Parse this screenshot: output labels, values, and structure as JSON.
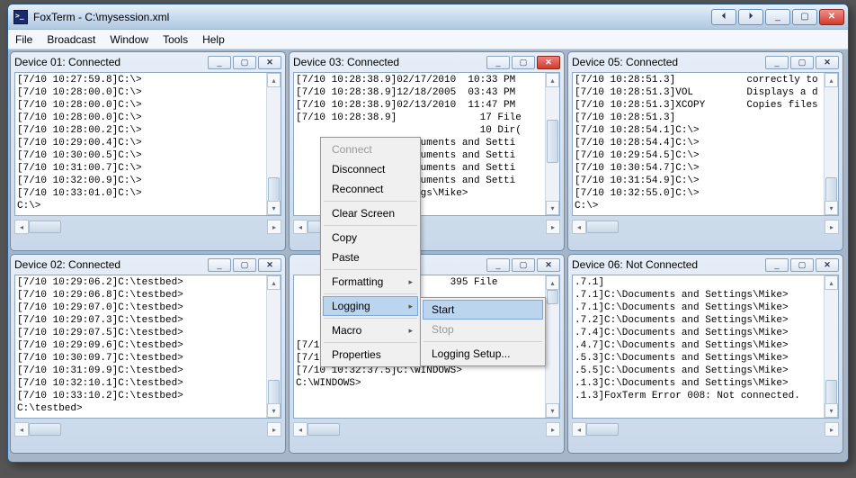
{
  "window": {
    "title": "FoxTerm - C:\\mysession.xml"
  },
  "titlebar_buttons": {
    "prev": "⏴",
    "next": "⏵",
    "min": "_",
    "max": "▢",
    "close": ""
  },
  "menubar": [
    "File",
    "Broadcast",
    "Window",
    "Tools",
    "Help"
  ],
  "children": {
    "d1": {
      "title": "Device 01: Connected",
      "lines": "[7/10 10:27:59.8]C:\\>\n[7/10 10:28:00.0]C:\\>\n[7/10 10:28:00.0]C:\\>\n[7/10 10:28:00.0]C:\\>\n[7/10 10:28:00.2]C:\\>\n[7/10 10:29:00.4]C:\\>\n[7/10 10:30:00.5]C:\\>\n[7/10 10:31:00.7]C:\\>\n[7/10 10:32:00.9]C:\\>\n[7/10 10:33:01.0]C:\\>\nC:\\>"
    },
    "d2": {
      "title": "Device 02: Connected",
      "lines": "[7/10 10:29:06.2]C:\\testbed>\n[7/10 10:29:06.8]C:\\testbed>\n[7/10 10:29:07.0]C:\\testbed>\n[7/10 10:29:07.3]C:\\testbed>\n[7/10 10:29:07.5]C:\\testbed>\n[7/10 10:29:09.6]C:\\testbed>\n[7/10 10:30:09.7]C:\\testbed>\n[7/10 10:31:09.9]C:\\testbed>\n[7/10 10:32:10.1]C:\\testbed>\n[7/10 10:33:10.2]C:\\testbed>\nC:\\testbed>"
    },
    "d3": {
      "title": "Device 03: Connected",
      "lines": "[7/10 10:28:38.9]02/17/2010  10:33 PM\n[7/10 10:28:38.9]12/18/2005  03:43 PM\n[7/10 10:28:38.9]02/13/2010  11:47 PM\n[7/10 10:28:38.9]              17 File\n                               10 Dir(\n                  Documents and Setti\n                  Documents and Setti\n                  Documents and Setti\n                  Documents and Setti\n                  tings\\Mike>"
    },
    "d4": {
      "title": "",
      "lines": "                          395 File\n\n\n\n                  NDOWS>\n[7/10 10:30:37.1]C:\\WINDOWS>\n[7/10 10:31:37.3]C:\\WINDOWS>\n[7/10 10:32:37.5]C:\\WINDOWS>\nC:\\WINDOWS>"
    },
    "d5": {
      "title": "Device 05: Connected",
      "lines": "[7/10 10:28:51.3]            correctly to\n[7/10 10:28:51.3]VOL         Displays a d\n[7/10 10:28:51.3]XCOPY       Copies files\n[7/10 10:28:51.3]\n[7/10 10:28:54.1]C:\\>\n[7/10 10:28:54.4]C:\\>\n[7/10 10:29:54.5]C:\\>\n[7/10 10:30:54.7]C:\\>\n[7/10 10:31:54.9]C:\\>\n[7/10 10:32:55.0]C:\\>\nC:\\>"
    },
    "d6": {
      "title": "Device 06: Not Connected",
      "lines": ".7.1]\n.7.1]C:\\Documents and Settings\\Mike>\n.7.1]C:\\Documents and Settings\\Mike>\n.7.2]C:\\Documents and Settings\\Mike>\n.7.4]C:\\Documents and Settings\\Mike>\n.4.7]C:\\Documents and Settings\\Mike>\n.5.3]C:\\Documents and Settings\\Mike>\n.5.5]C:\\Documents and Settings\\Mike>\n.1.3]C:\\Documents and Settings\\Mike>\n.1.3]FoxTerm Error 008: Not connected."
    }
  },
  "context_menu": {
    "items": [
      {
        "label": "Connect",
        "disabled": true
      },
      {
        "label": "Disconnect"
      },
      {
        "label": "Reconnect"
      },
      {
        "sep": true
      },
      {
        "label": "Clear Screen"
      },
      {
        "sep": true
      },
      {
        "label": "Copy"
      },
      {
        "label": "Paste"
      },
      {
        "sep": true
      },
      {
        "label": "Formatting",
        "submenu": true
      },
      {
        "sep": true
      },
      {
        "label": "Logging",
        "submenu": true,
        "hover": true
      },
      {
        "sep": true
      },
      {
        "label": "Macro",
        "submenu": true
      },
      {
        "sep": true
      },
      {
        "label": "Properties"
      }
    ]
  },
  "logging_submenu": [
    {
      "label": "Start",
      "hover": true
    },
    {
      "label": "Stop",
      "disabled": true
    },
    {
      "sep": true
    },
    {
      "label": "Logging Setup..."
    }
  ],
  "mdi_buttons": {
    "min": "_",
    "max": "▢",
    "close": ""
  },
  "scroll_arrows": {
    "up": "▴",
    "down": "▾",
    "left": "◂",
    "right": "▸"
  }
}
